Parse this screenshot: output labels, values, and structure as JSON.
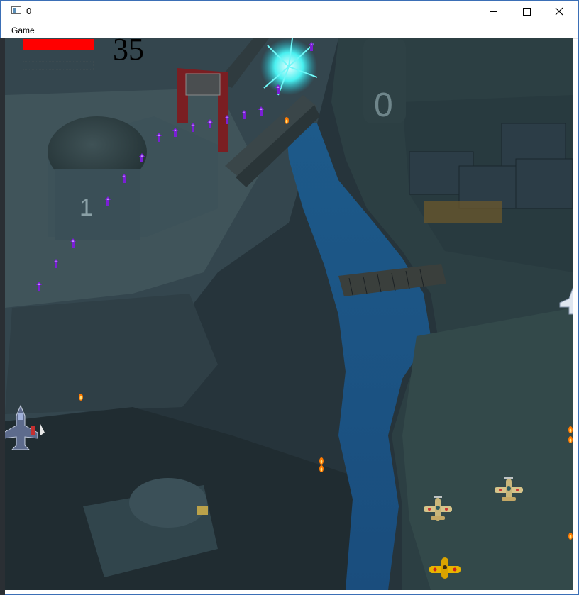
{
  "window": {
    "title": "0",
    "menu": [
      "Game"
    ]
  },
  "hud": {
    "score": "35",
    "health_fraction": 1.0
  },
  "colors": {
    "health": "#ff0000",
    "player_bullet": "#7b1fd6",
    "enemy_bullet": "#ff8a00",
    "explosion": "#3ef0f0"
  },
  "sprites": {
    "player": "jet-fighter",
    "enemies": [
      "propeller-plane-green",
      "propeller-plane-yellow",
      "jet-fighter-white"
    ],
    "effects": [
      "explosion"
    ]
  },
  "terrain": {
    "building_marks": [
      "1",
      "0"
    ]
  }
}
